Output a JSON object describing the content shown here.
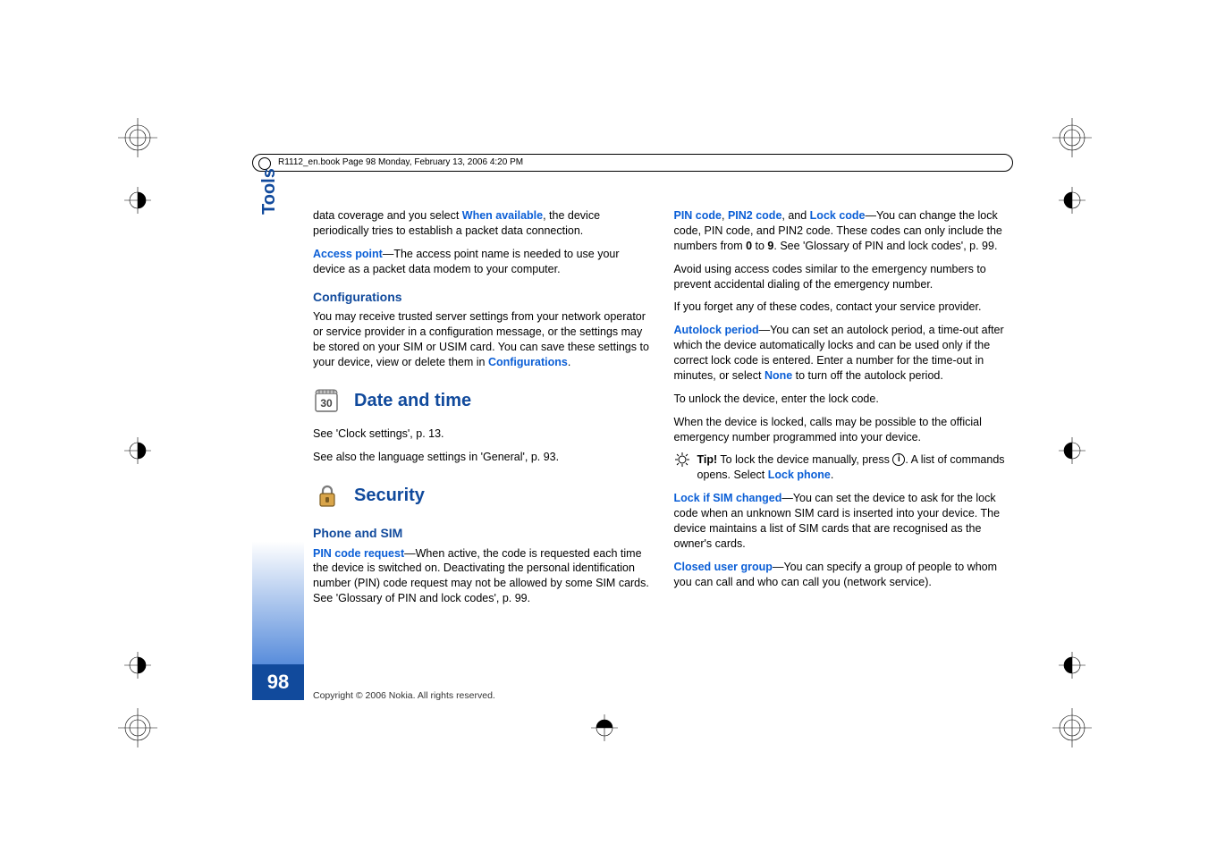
{
  "header": {
    "text": "R1112_en.book  Page 98  Monday, February 13, 2006  4:20 PM"
  },
  "sidebar": {
    "section_label": "Tools",
    "page_number": "98"
  },
  "left_column": {
    "p1_a": "data coverage and you select ",
    "p1_link": "When available",
    "p1_b": ", the device periodically tries to establish a packet data connection.",
    "p2_link": "Access point",
    "p2_b": "—The access point name is needed to use your device as a packet data modem to your computer.",
    "h3_config": "Configurations",
    "p3_a": "You may receive trusted server settings from your network operator or service provider in a configuration message, or the settings may be stored on your SIM or USIM card. You can save these settings to your device, view or delete them in ",
    "p3_link": "Configurations",
    "p3_c": ".",
    "h2_date": "Date and time",
    "p4": "See 'Clock settings', p. 13.",
    "p5": "See also the language settings in 'General', p. 93.",
    "h2_security": "Security",
    "h3_phone": "Phone and SIM",
    "p6_link": "PIN code request",
    "p6_b": "—When active, the code is requested each time the device is switched on. Deactivating the personal identification number (PIN) code request may not be allowed by some SIM cards. See 'Glossary of PIN and lock codes', p. 99."
  },
  "right_column": {
    "p1_link1": "PIN code",
    "p1_sep1": ", ",
    "p1_link2": "PIN2 code",
    "p1_sep2": ", and ",
    "p1_link3": "Lock code",
    "p1_b": "—You can change the lock code, PIN code, and PIN2 code. These codes can only include the numbers from ",
    "p1_bold1": "0",
    "p1_mid": " to ",
    "p1_bold2": "9",
    "p1_c": ". See 'Glossary of PIN and lock codes', p. 99.",
    "p2": "Avoid using access codes similar to the emergency numbers to prevent accidental dialing of the emergency number.",
    "p3": "If you forget any of these codes, contact your service provider.",
    "p4_link": "Autolock period",
    "p4_b": "—You can set an autolock period, a time-out after which the device automatically locks and can be used only if the correct lock code is entered. Enter a number for the time-out in minutes, or select ",
    "p4_link2": "None",
    "p4_c": " to turn off the autolock period.",
    "p5": "To unlock the device, enter the lock code.",
    "p6": "When the device is locked, calls may be possible to the official emergency number programmed into your device.",
    "tip_label": "Tip!",
    "tip_a": " To lock the device manually, press ",
    "tip_b": ". A list of commands opens. Select ",
    "tip_link": "Lock phone",
    "tip_c": ".",
    "p7_link": "Lock if SIM changed",
    "p7_b": "—You can set the device to ask for the lock code when an unknown SIM card is inserted into your device. The device maintains a list of SIM cards that are recognised as the owner's cards.",
    "p8_link": "Closed user group",
    "p8_b": "—You can specify a group of people to whom you can call and who can call you (network service)."
  },
  "footer": {
    "copyright": "Copyright © 2006 Nokia. All rights reserved."
  },
  "icons": {
    "calendar_text": "30"
  }
}
